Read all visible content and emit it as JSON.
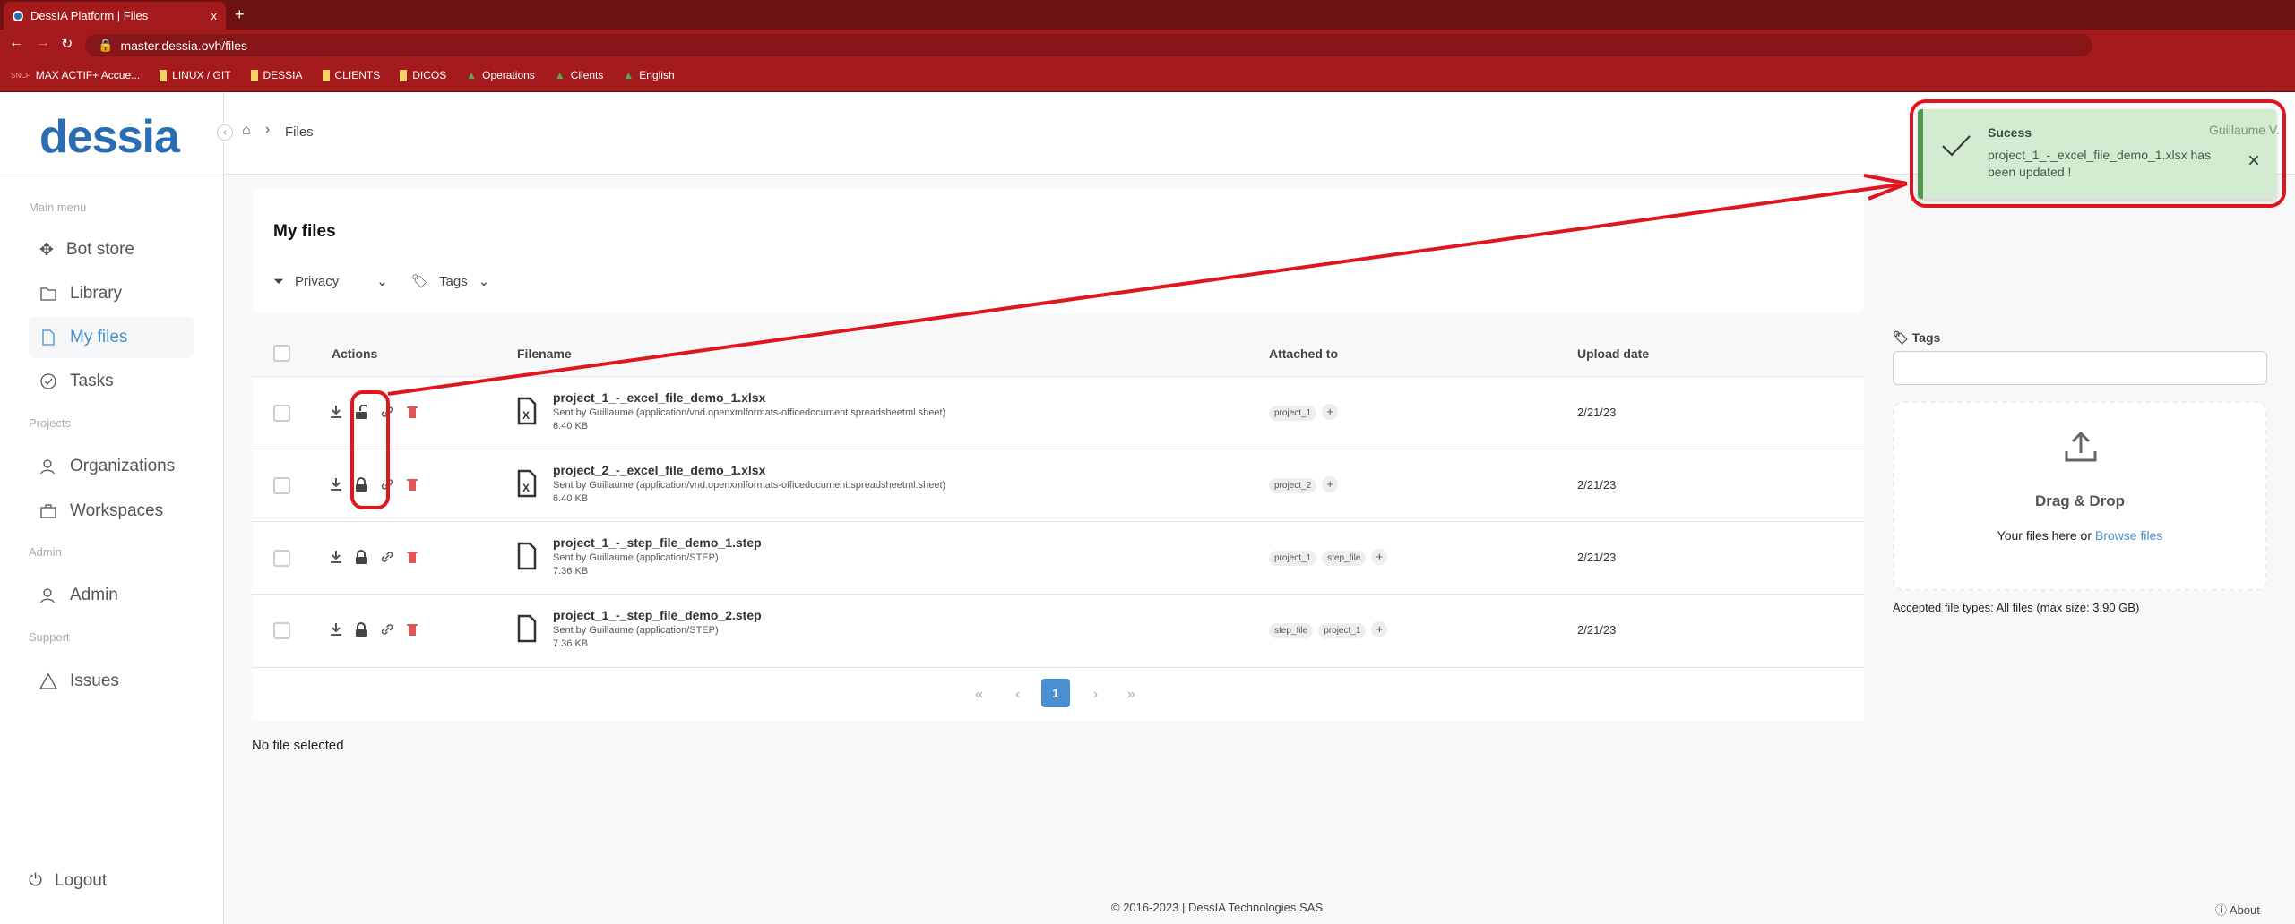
{
  "browser": {
    "tab_title": "DessIA Platform | Files",
    "tab_close": "x",
    "new_tab": "+",
    "url": "master.dessia.ovh/files",
    "bookmarks": [
      "MAX ACTIF+ Accue...",
      "LINUX / GIT",
      "DESSIA",
      "CLIENTS",
      "DICOS",
      "Operations",
      "Clients",
      "English"
    ]
  },
  "logo": "dessia",
  "breadcrumb": {
    "current": "Files"
  },
  "user": "Guillaume V.",
  "sidebar": {
    "sections": [
      {
        "label": "Main menu",
        "items": [
          {
            "label": "Bot store",
            "icon": "bot-store-icon"
          },
          {
            "label": "Library",
            "icon": "folder-icon"
          },
          {
            "label": "My files",
            "icon": "file-icon",
            "active": true
          },
          {
            "label": "Tasks",
            "icon": "check-circle-icon"
          }
        ]
      },
      {
        "label": "Projects",
        "items": [
          {
            "label": "Organizations",
            "icon": "organization-icon"
          },
          {
            "label": "Workspaces",
            "icon": "briefcase-icon"
          }
        ]
      },
      {
        "label": "Admin",
        "items": [
          {
            "label": "Admin",
            "icon": "user-icon"
          }
        ]
      },
      {
        "label": "Support",
        "items": [
          {
            "label": "Issues",
            "icon": "warning-icon"
          }
        ]
      }
    ],
    "logout": "Logout"
  },
  "main": {
    "title": "My files",
    "filters": {
      "privacy": "Privacy",
      "tags": "Tags"
    },
    "columns": [
      "Actions",
      "Filename",
      "Attached to",
      "Upload date"
    ],
    "rows": [
      {
        "name": "project_1_-_excel_file_demo_1.xlsx",
        "sub": "Sent by Guillaume (application/vnd.openxmlformats-officedocument.spreadsheetml.sheet)",
        "size": "6.40 KB",
        "tags": [
          "project_1"
        ],
        "date": "2/21/23",
        "locked": false,
        "type": "excel"
      },
      {
        "name": "project_2_-_excel_file_demo_1.xlsx",
        "sub": "Sent by Guillaume (application/vnd.openxmlformats-officedocument.spreadsheetml.sheet)",
        "size": "6.40 KB",
        "tags": [
          "project_2"
        ],
        "date": "2/21/23",
        "locked": true,
        "type": "excel"
      },
      {
        "name": "project_1_-_step_file_demo_1.step",
        "sub": "Sent by Guillaume (application/STEP)",
        "size": "7.36 KB",
        "tags": [
          "project_1",
          "step_file"
        ],
        "date": "2/21/23",
        "locked": true,
        "type": "file"
      },
      {
        "name": "project_1_-_step_file_demo_2.step",
        "sub": "Sent by Guillaume (application/STEP)",
        "size": "7.36 KB",
        "tags": [
          "step_file",
          "project_1"
        ],
        "date": "2/21/23",
        "locked": true,
        "type": "file"
      }
    ],
    "pagination": {
      "first": "«",
      "prev": "‹",
      "current": "1",
      "next": "›",
      "last": "»"
    },
    "selection": "No file selected"
  },
  "upload": {
    "tags_label": "Tags",
    "drag_title": "Drag & Drop",
    "drag_text": "Your files here or ",
    "browse": "Browse files",
    "accepted": "Accepted file types: All files (max size: 3.90 GB)"
  },
  "toast": {
    "title": "Sucess",
    "message": "project_1_-_excel_file_demo_1.xlsx has been updated !",
    "close": "×"
  },
  "footer": {
    "copyright": "© 2016-2023 | DessIA Technologies SAS",
    "about": "About"
  },
  "colors": {
    "accent": "#4a8fd0",
    "toast_bg": "#d3ebd0",
    "toast_bar": "#4f9a52",
    "annotation": "#e0161e",
    "delete": "#e05555"
  }
}
